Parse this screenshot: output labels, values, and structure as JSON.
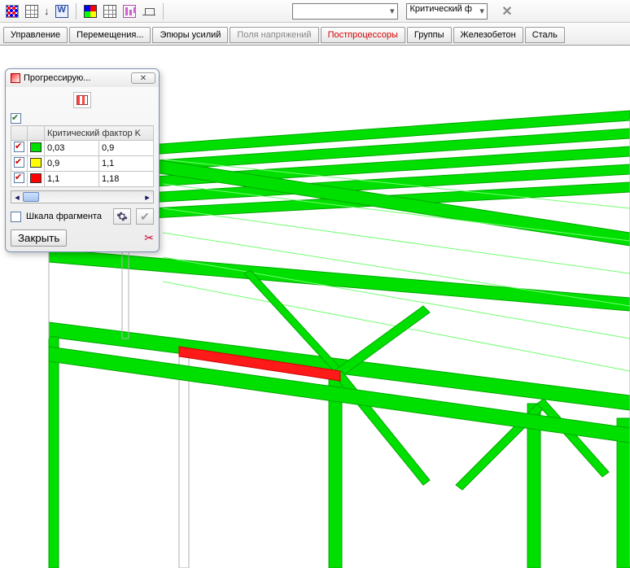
{
  "toolbar": {
    "combo_analysis": "Критический ф"
  },
  "tabs": {
    "control": "Управление",
    "displacements": "Перемещения...",
    "diagrams": "Эпюры усилий",
    "stressfields": "Поля напряжений",
    "postproc": "Постпроцессоры",
    "groups": "Группы",
    "rc": "Железобетон",
    "steel": "Сталь"
  },
  "palette": {
    "title": "Прогрессирую...",
    "header_factor": "Критический фактор K",
    "rows": [
      {
        "from": "0,03",
        "to": "0,9"
      },
      {
        "from": "0,9",
        "to": "1,1"
      },
      {
        "from": "1,1",
        "to": "1,18"
      }
    ],
    "fragment_label": "Шкала фрагмента",
    "close_label": "Закрыть"
  },
  "colors": {
    "ok": "#00e000",
    "warn": "#ffff00",
    "crit": "#ff0000"
  }
}
